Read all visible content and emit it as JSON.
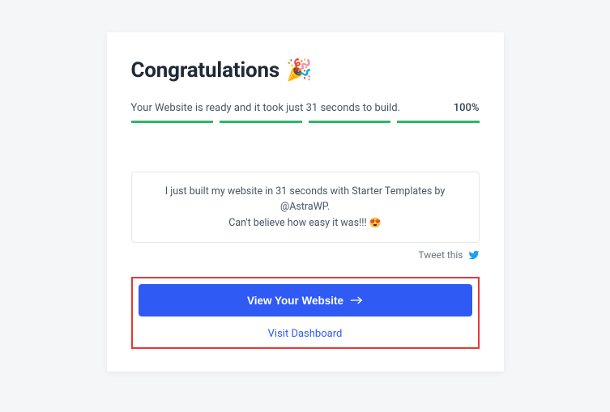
{
  "title": "Congratulations",
  "title_emoji": "🎉",
  "status": {
    "text": "Your Website is ready and it took just 31 seconds to build.",
    "percent": "100%"
  },
  "progress": {
    "segments": 4
  },
  "tweet": {
    "line1": "I just built my website in 31 seconds with Starter Templates by @AstraWP.",
    "line2": "Can't believe how easy it was!!! ",
    "emoji": "😍",
    "link_label": "Tweet this"
  },
  "actions": {
    "primary_label": "View Your Website",
    "secondary_label": "Visit Dashboard"
  }
}
